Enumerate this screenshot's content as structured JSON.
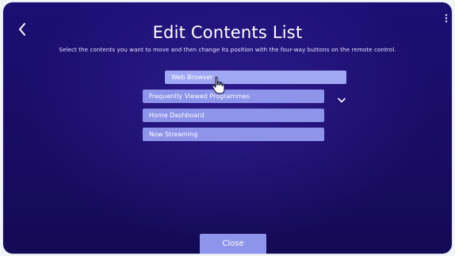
{
  "header": {
    "title": "Edit Contents List",
    "subtitle": "Select the contents you want to move and then change its position with the four-way buttons on the remote control."
  },
  "list": {
    "items": [
      {
        "label": "Web Browser",
        "selected": true
      },
      {
        "label": "Frequently Viewed Programmes",
        "selected": false
      },
      {
        "label": "Home Dashboard",
        "selected": false
      },
      {
        "label": "Now Streaming",
        "selected": false
      }
    ]
  },
  "footer": {
    "close_label": "Close"
  },
  "icons": {
    "back": "chevron-left-icon",
    "more": "more-vertical-icon",
    "move_down": "chevron-down-icon",
    "pointer": "hand-pointer-icon"
  },
  "colors": {
    "background": "#1a0c66",
    "item": "#8e94ea",
    "item_selected": "#a0a8f4",
    "text": "#ffffff"
  }
}
